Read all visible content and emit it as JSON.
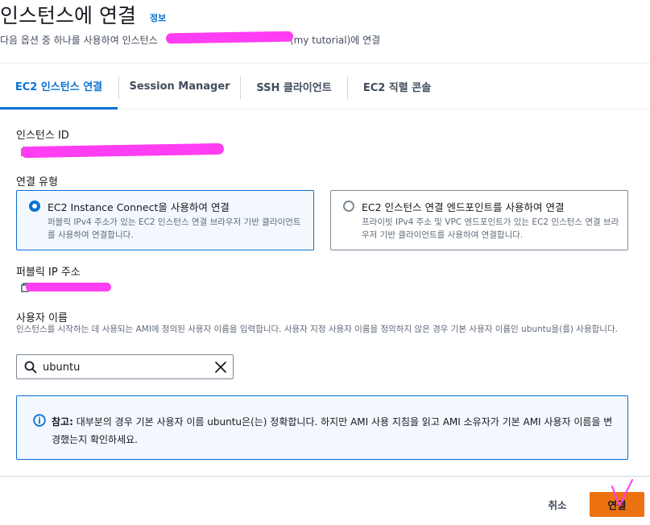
{
  "header": {
    "title": "인스턴스에 연결",
    "info_link": "정보",
    "subtitle_prefix": "다음 옵션 중 하나를 사용하여 인스턴스",
    "subtitle_suffix": "(my tutorial)에 연결"
  },
  "tabs": [
    {
      "label": "EC2 인스턴스 연결",
      "active": true
    },
    {
      "label": "Session Manager",
      "active": false
    },
    {
      "label": "SSH 클라이언트",
      "active": false
    },
    {
      "label": "EC2 직렬 콘솔",
      "active": false
    }
  ],
  "instance_id": {
    "label": "인스턴스 ID"
  },
  "connection_type": {
    "label": "연결 유형",
    "options": [
      {
        "title": "EC2 Instance Connect을 사용하여 연결",
        "description": "퍼블릭 IPv4 주소가 있는 EC2 인스턴스 연결 브라우저 기반 클라이언트를 사용하여 연결합니다.",
        "selected": true
      },
      {
        "title": "EC2 인스턴스 연결 엔드포인트를 사용하여 연결",
        "description": "프라이빗 IPv4 주소 및 VPC 엔드포인트가 있는 EC2 인스턴스 연결 브라우저 기반 클라이언트를 사용하여 연결합니다.",
        "selected": false
      }
    ]
  },
  "public_ip": {
    "label": "퍼블릭 IP 주소"
  },
  "username": {
    "label": "사용자 이름",
    "description": "인스턴스를 시작하는 데 사용되는 AMI에 정의된 사용자 이름을 입력합니다. 사용자 지정 사용자 이름을 정의하지 않은 경우 기본 사용자 이름인 ubuntu을(를) 사용합니다.",
    "value": "ubuntu"
  },
  "alert": {
    "bold": "참고:",
    "text": " 대부분의 경우 기본 사용자 이름 ubuntu은(는) 정확합니다. 하지만 AMI 사용 지침을 읽고 AMI 소유자가 기본 AMI 사용자 이름을 변경했는지 확인하세요."
  },
  "footer": {
    "cancel": "취소",
    "connect": "연결"
  },
  "colors": {
    "accent": "#0972d3",
    "primary_button": "#ec7211",
    "redaction": "#ff3df2"
  }
}
